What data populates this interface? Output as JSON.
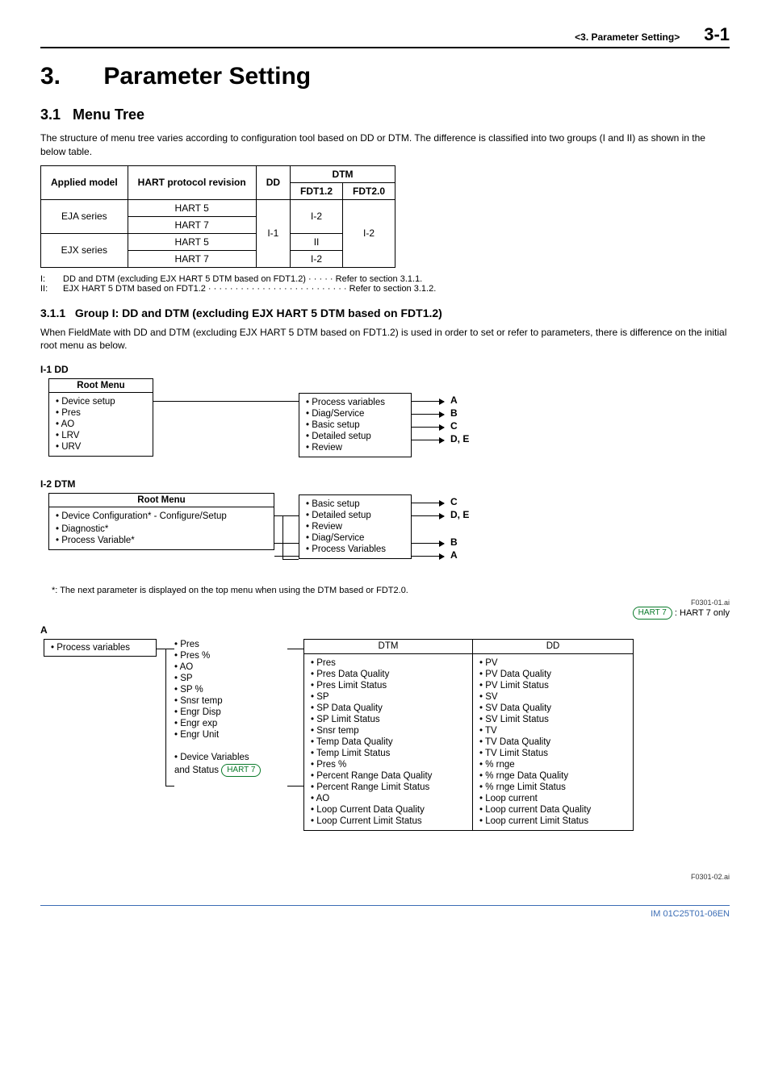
{
  "header": {
    "section_ref": "<3.  Parameter Setting>",
    "page_num": "3-1"
  },
  "h1": {
    "num": "3.",
    "title": "Parameter Setting"
  },
  "h2": {
    "num": "3.1",
    "title": "Menu Tree"
  },
  "intro": "The structure of menu tree varies according to configuration tool based on DD or DTM. The difference is classified into two groups (I and II) as shown in the below table.",
  "table": {
    "headers": {
      "applied": "Applied model",
      "hart": "HART protocol revision",
      "dd": "DD",
      "dtm": "DTM",
      "fdt12": "FDT1.2",
      "fdt20": "FDT2.0"
    },
    "rows": {
      "eja": "EJA series",
      "ejx": "EJX series",
      "h5": "HART 5",
      "h7": "HART 7",
      "i1": "I-1",
      "i2": "I-2",
      "ii": "II"
    }
  },
  "notes": {
    "i_lbl": "I:",
    "i_txt": "DD and DTM (excluding EJX HART 5 DTM based on FDT1.2) · · · · · Refer to section 3.1.1.",
    "ii_lbl": "II:",
    "ii_txt": "EJX HART 5 DTM based on FDT1.2  · · · · · · · · · · · · · · · · · · · · · · · · · · Refer to section 3.1.2."
  },
  "h3": {
    "num": "3.1.1",
    "title": "Group I: DD and DTM (excluding EJX HART 5 DTM based on FDT1.2)"
  },
  "h3_body": "When FieldMate with DD and DTM (excluding EJX HART 5 DTM based on FDT1.2) is used in order to set or refer to parameters, there is difference on the initial root menu as below.",
  "i1": {
    "heading": "I-1  DD",
    "root_title": "Root Menu",
    "root_items": [
      "• Device setup",
      "• Pres",
      "• AO",
      "• LRV",
      "• URV"
    ],
    "sub_items": [
      "• Process variables",
      "• Diag/Service",
      "• Basic setup",
      "• Detailed setup",
      "• Review"
    ],
    "targets": [
      "A",
      "B",
      "C",
      "D, E"
    ]
  },
  "i2": {
    "heading": "I-2  DTM",
    "root_title": "Root Menu",
    "root_items": [
      "• Device Configuration* - Configure/Setup",
      "",
      "• Diagnostic*",
      "• Process Variable*"
    ],
    "sub_items": [
      "• Basic setup",
      "• Detailed setup",
      "• Review",
      "• Diag/Service",
      "• Process Variables"
    ],
    "targets": [
      "C",
      "D, E",
      "",
      "B",
      "A"
    ],
    "footnote": "*:   The next parameter is displayed on the top menu when using the DTM based or FDT2.0."
  },
  "fig1_ref": "F0301-01.ai",
  "hart7_badge": "HART 7",
  "hart7_legend": " : HART 7 only",
  "A": {
    "label": "A",
    "left_title": "• Process variables",
    "mid_items": [
      "• Pres",
      "• Pres %",
      "• AO",
      "• SP",
      "• SP %",
      "• Snsr temp",
      "• Engr Disp",
      "• Engr exp",
      "• Engr Unit",
      "",
      "• Device Variables",
      "  and Status"
    ],
    "mid_badge_row": 11,
    "dtm_title": "DTM",
    "dtm_items": [
      "• Pres",
      "• Pres Data Quality",
      "• Pres Limit Status",
      "• SP",
      "• SP Data Quality",
      "• SP Limit Status",
      "• Snsr temp",
      "• Temp Data Quality",
      "• Temp Limit Status",
      "• Pres %",
      "• Percent Range Data Quality",
      "• Percent Range Limit Status",
      "• AO",
      "• Loop Current Data Quality",
      "• Loop Current Limit Status"
    ],
    "dd_title": "DD",
    "dd_items": [
      "• PV",
      "• PV Data Quality",
      "• PV Limit Status",
      "• SV",
      "• SV Data Quality",
      "• SV Limit Status",
      "• TV",
      "• TV Data Quality",
      "• TV Limit Status",
      "• % rnge",
      "• % rnge Data Quality",
      "• % rnge Limit Status",
      "• Loop current",
      "• Loop current Data Quality",
      "• Loop current Limit Status"
    ]
  },
  "fig2_ref": "F0301-02.ai",
  "footer": "IM 01C25T01-06EN"
}
